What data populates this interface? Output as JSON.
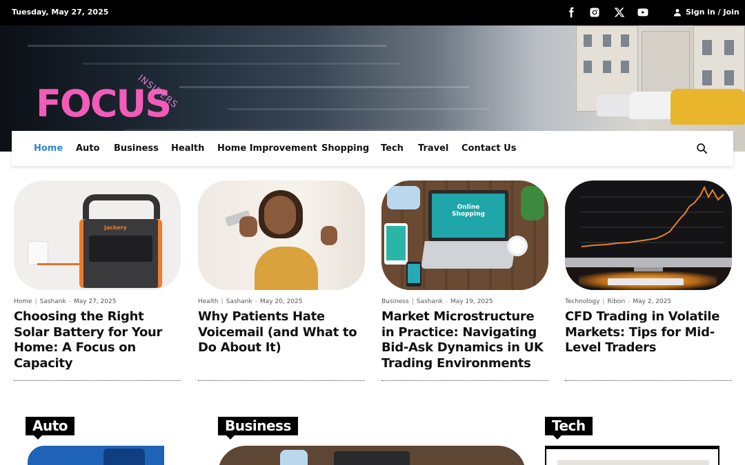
{
  "topbar": {
    "date": "Tuesday, May 27, 2025",
    "social_icons": [
      "facebook-icon",
      "instagram-icon",
      "x-icon",
      "youtube-icon"
    ],
    "signin_label": "Sign in / Join"
  },
  "brand": {
    "logo_main": "FOCUS",
    "logo_sub": "INSIDERS",
    "logo_color": "#f25cb8"
  },
  "nav": {
    "items": [
      "Home",
      "Auto",
      "Business",
      "Health",
      "Home Improvement",
      "Shopping",
      "Tech",
      "Travel",
      "Contact Us"
    ],
    "active_color": "#2d87d1"
  },
  "articles": [
    {
      "category": "Home",
      "author": "Sashank",
      "date": "May 27, 2025",
      "title": "Choosing the Right Solar Battery for Your Home: A Focus on Capacity",
      "brand_text": "Jackery"
    },
    {
      "category": "Health",
      "author": "Sashank",
      "date": "May 20, 2025",
      "title": "Why Patients Hate Voicemail (and What to Do About It)"
    },
    {
      "category": "Business",
      "author": "Sashank",
      "date": "May 19, 2025",
      "title": "Market Microstructure in Practice: Navigating Bid-Ask Dynamics in UK Trading Environments",
      "screen_text": "Online Shopping"
    },
    {
      "category": "Technology",
      "author": "Ribon",
      "date": "May 2, 2025",
      "title": "CFD Trading in Volatile Markets: Tips for Mid-Level Traders"
    }
  ],
  "sections": [
    "Auto",
    "Business",
    "Tech"
  ]
}
